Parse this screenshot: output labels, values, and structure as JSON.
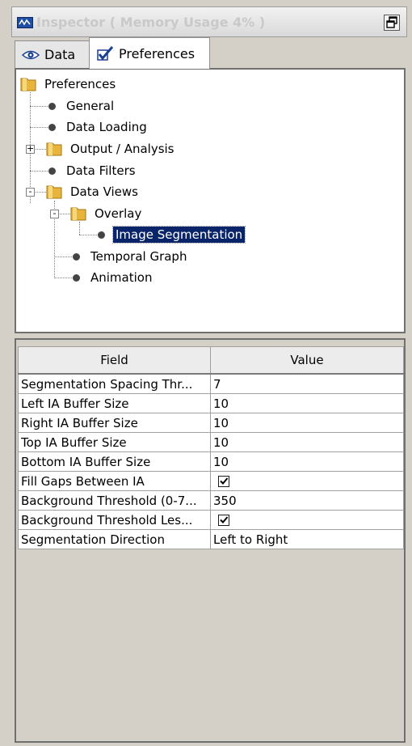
{
  "window": {
    "title": "Inspector ( Memory Usage 4% )"
  },
  "tabs": [
    {
      "label": "Data",
      "icon": "eye-icon",
      "active": false
    },
    {
      "label": "Preferences",
      "icon": "checkbox-icon",
      "active": true
    }
  ],
  "tree": {
    "root": "Preferences",
    "items": [
      {
        "label": "General",
        "icon": "bullet-icon"
      },
      {
        "label": "Data Loading",
        "icon": "bullet-icon"
      },
      {
        "label": "Output / Analysis",
        "icon": "folder-icon",
        "expander": "+"
      },
      {
        "label": "Data Filters",
        "icon": "bullet-icon"
      },
      {
        "label": "Data Views",
        "icon": "folder-icon",
        "expander": "-"
      },
      {
        "label": "Overlay",
        "icon": "folder-icon",
        "expander": "-"
      },
      {
        "label": "Image Segmentation",
        "icon": "bullet-icon",
        "selected": true
      },
      {
        "label": "Temporal Graph",
        "icon": "bullet-icon"
      },
      {
        "label": "Animation",
        "icon": "bullet-icon"
      }
    ]
  },
  "grid": {
    "headers": [
      "Field",
      "Value"
    ],
    "rows": [
      {
        "field": "Segmentation Spacing Thr...",
        "value": "7"
      },
      {
        "field": "Left IA Buffer Size",
        "value": "10"
      },
      {
        "field": "Right IA Buffer Size",
        "value": "10"
      },
      {
        "field": "Top IA Buffer Size",
        "value": "10"
      },
      {
        "field": "Bottom IA Buffer Size",
        "value": "10"
      },
      {
        "field": "Fill Gaps Between IA",
        "value": "",
        "checked": true
      },
      {
        "field": "Background Threshold (0-7...",
        "value": "350"
      },
      {
        "field": "Background Threshold Les...",
        "value": "",
        "checked": true
      },
      {
        "field": "Segmentation Direction",
        "value": "Left to Right"
      }
    ]
  },
  "colors": {
    "selection": "#0a246a",
    "folder": "#f0c040",
    "title_text": "#c9c9c9"
  }
}
